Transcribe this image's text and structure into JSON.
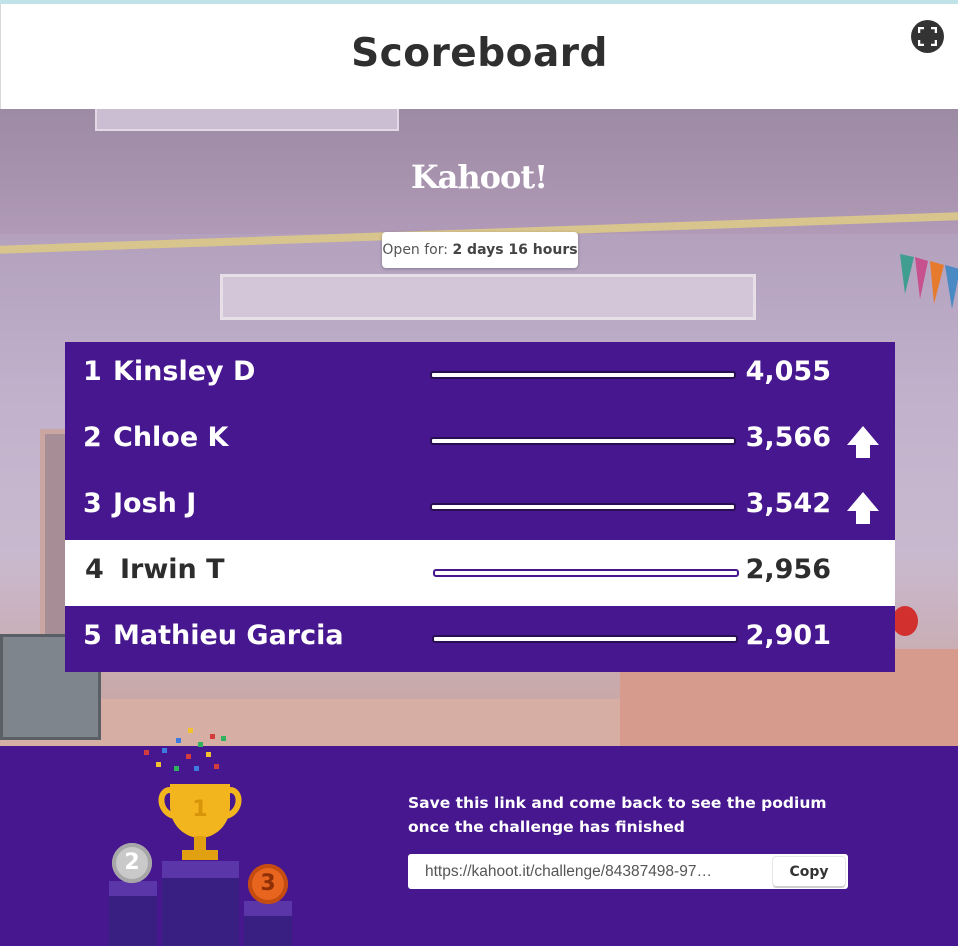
{
  "header": {
    "title": "Scoreboard",
    "fullscreen_icon": "fullscreen-icon"
  },
  "brand": {
    "logo": "Kahoot!"
  },
  "status": {
    "open_for_label": "Open for:",
    "open_for_value": "2 days 16 hours"
  },
  "scoreboard": {
    "accent": "#46178f",
    "rows": [
      {
        "rank": "1",
        "name": "Kinsley D",
        "score": "4,055",
        "trend": ""
      },
      {
        "rank": "2",
        "name": "Chloe K",
        "score": "3,566",
        "trend": "up-arrow-icon"
      },
      {
        "rank": "3",
        "name": "Josh J",
        "score": "3,542",
        "trend": "up-arrow-icon"
      },
      {
        "rank": "4",
        "name": "Irwin T",
        "score": "2,956",
        "trend": "",
        "highlighted": true
      },
      {
        "rank": "5",
        "name": "Mathieu Garcia",
        "score": "2,901",
        "trend": ""
      }
    ]
  },
  "footer": {
    "message": "Save this link and come back to see the podium once the challenge has finished",
    "link": "https://kahoot.it/challenge/84387498-97…",
    "copy_label": "Copy",
    "medals": {
      "second": "2",
      "third": "3",
      "trophy_number": "1"
    }
  }
}
